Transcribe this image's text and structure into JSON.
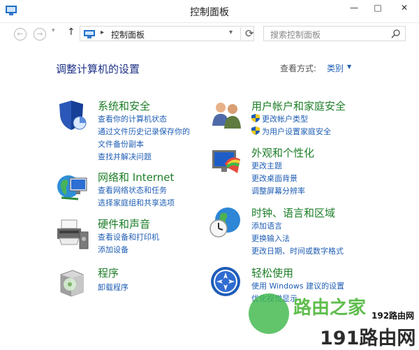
{
  "window": {
    "title": "控制面板",
    "minimize": "—",
    "maximize": "□",
    "close": "✕"
  },
  "navbar": {
    "back": "←",
    "forward": "→",
    "recent": "▾",
    "up": "↑",
    "address": "控制面板",
    "address_separator": "▸",
    "address_dropdown": "▾",
    "refresh": "⟳",
    "search_placeholder": "搜索控制面板"
  },
  "main": {
    "heading": "调整计算机的设置",
    "view_label": "查看方式:",
    "view_value": "类别",
    "view_arrow": "▼"
  },
  "categories": [
    {
      "title": "系统和安全",
      "icon": "system-security-shield-icon",
      "links": [
        "查看你的计算机状态",
        "通过文件历史记录保存你的",
        "文件备份副本",
        "查找并解决问题"
      ]
    },
    {
      "title": "网络和 Internet",
      "icon": "network-globe-icon",
      "links": [
        "查看网络状态和任务",
        "选择家庭组和共享选项"
      ]
    },
    {
      "title": "硬件和声音",
      "icon": "hardware-printer-icon",
      "links": [
        "查看设备和打印机",
        "添加设备"
      ]
    },
    {
      "title": "程序",
      "icon": "programs-box-icon",
      "links": [
        "卸载程序"
      ]
    },
    {
      "title": "用户帐户和家庭安全",
      "icon": "users-icon",
      "links": [
        "更改帐户类型",
        "为用户设置家庭安全"
      ]
    },
    {
      "title": "外观和个性化",
      "icon": "appearance-monitor-icon",
      "links": [
        "更改主题",
        "更改桌面背景",
        "调整屏幕分辨率"
      ]
    },
    {
      "title": "时钟、语言和区域",
      "icon": "clock-globe-icon",
      "links": [
        "添加语言",
        "更换输入法",
        "更改日期、时间或数字格式"
      ]
    },
    {
      "title": "轻松使用",
      "icon": "ease-of-access-icon",
      "links": [
        "使用 Windows 建议的设置",
        "优化视觉显示"
      ]
    }
  ],
  "watermark": {
    "line1": "路由之家",
    "line2": "192路由网",
    "line3": "191路由网"
  },
  "colors": {
    "category_title": "#1d7e28",
    "link": "#1f5eb4",
    "heading": "#1e3287"
  }
}
